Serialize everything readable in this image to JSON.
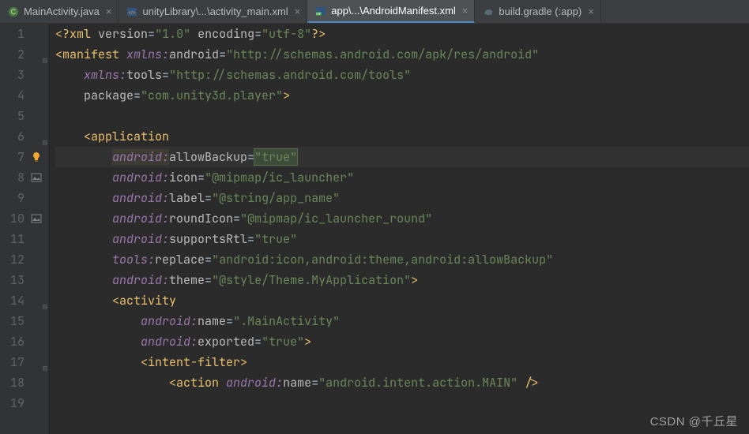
{
  "tabs": [
    {
      "label": "MainActivity.java",
      "icon": "class-c"
    },
    {
      "label": "unityLibrary\\...\\activity_main.xml",
      "icon": "xml"
    },
    {
      "label": "app\\...\\AndroidManifest.xml",
      "icon": "manifest",
      "active": true
    },
    {
      "label": "build.gradle (:app)",
      "icon": "gradle"
    }
  ],
  "watermark": "CSDN @千丘星",
  "gutter": {
    "bulb_line": 7,
    "image_icon_lines": [
      8,
      10
    ]
  },
  "code": {
    "line1": {
      "open": "<?",
      "tag": "xml ",
      "a1n": "version",
      "a1v": "\"1.0\"",
      "a2n": " encoding",
      "a2v": "\"utf-8\"",
      "close": "?>"
    },
    "line2": {
      "open": "<",
      "tag": "manifest ",
      "ns": "xmlns:",
      "attr": "android",
      "eq": "=",
      "val": "\"http://schemas.android.com/apk/res/android\""
    },
    "line3": {
      "ns": "xmlns:",
      "attr": "tools",
      "eq": "=",
      "val": "\"http://schemas.android.com/tools\""
    },
    "line4": {
      "attr": "package",
      "eq": "=",
      "val": "\"com.unity3d.player\"",
      "close": ">"
    },
    "line6": {
      "open": "<",
      "tag": "application"
    },
    "line7": {
      "ns": "android:",
      "attr": "allowBackup",
      "eq": "=",
      "val": "\"true\""
    },
    "line8": {
      "ns": "android:",
      "attr": "icon",
      "eq": "=",
      "val": "\"@mipmap/ic_launcher\""
    },
    "line9": {
      "ns": "android:",
      "attr": "label",
      "eq": "=",
      "val": "\"@string/app_name\""
    },
    "line10": {
      "ns": "android:",
      "attr": "roundIcon",
      "eq": "=",
      "val": "\"@mipmap/ic_launcher_round\""
    },
    "line11": {
      "ns": "android:",
      "attr": "supportsRtl",
      "eq": "=",
      "val": "\"true\""
    },
    "line12": {
      "ns": "tools:",
      "attr": "replace",
      "eq": "=",
      "val": "\"android:icon,android:theme,android:allowBackup\""
    },
    "line13": {
      "ns": "android:",
      "attr": "theme",
      "eq": "=",
      "val": "\"@style/Theme.MyApplication\"",
      "close": ">"
    },
    "line14": {
      "open": "<",
      "tag": "activity"
    },
    "line15": {
      "ns": "android:",
      "attr": "name",
      "eq": "=",
      "val": "\".MainActivity\""
    },
    "line16": {
      "ns": "android:",
      "attr": "exported",
      "eq": "=",
      "val": "\"true\"",
      "close": ">"
    },
    "line17": {
      "open": "<",
      "tag": "intent-filter",
      "close": ">"
    },
    "line18": {
      "open": "<",
      "tag": "action ",
      "ns": "android:",
      "attr": "name",
      "eq": "=",
      "val": "\"android.intent.action.MAIN\"",
      "close": " />"
    }
  }
}
